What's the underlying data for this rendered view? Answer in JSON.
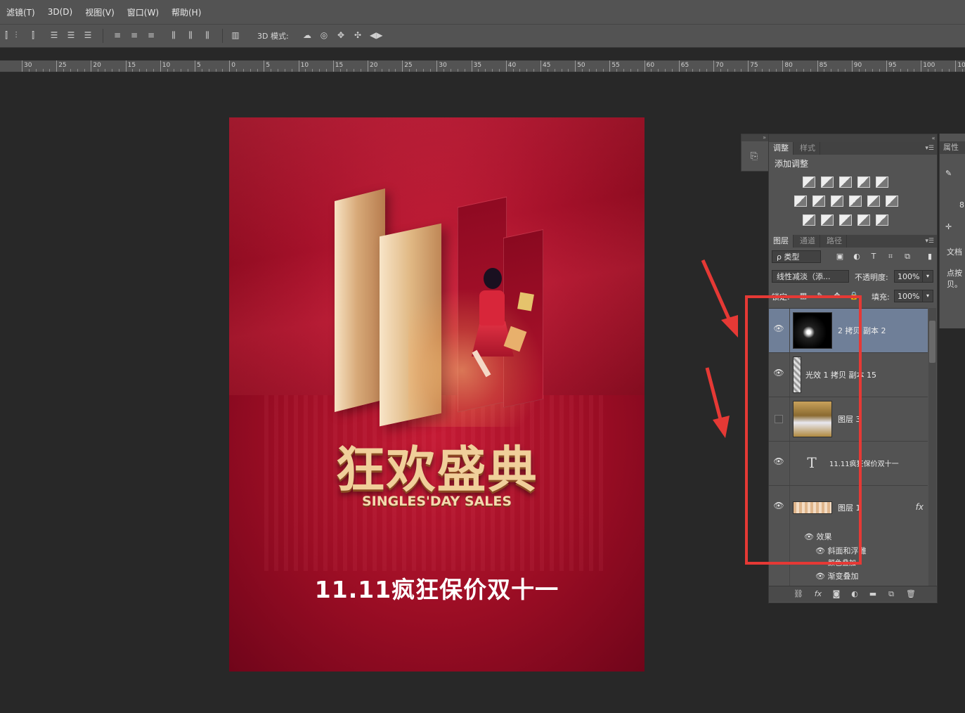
{
  "menu": [
    "滤镜(T)",
    "3D(D)",
    "视图(V)",
    "窗口(W)",
    "帮助(H)"
  ],
  "options_bar": {
    "mode_label": "3D 模式:"
  },
  "ruler": {
    "ticks": [
      "30",
      "25",
      "20",
      "15",
      "10",
      "5",
      "0",
      "5",
      "10",
      "15",
      "20",
      "25",
      "30",
      "35",
      "40",
      "45",
      "50",
      "55",
      "60",
      "65",
      "70",
      "75",
      "80",
      "85",
      "90",
      "95",
      "100",
      "10"
    ]
  },
  "poster": {
    "title": "狂欢盛典",
    "subtitle": "SINGLES'DAY SALES",
    "slogan": "11.11疯狂保价双十一"
  },
  "adjustments_panel": {
    "tabs": [
      "调整",
      "样式"
    ],
    "heading": "添加调整"
  },
  "properties_panel": {
    "tab": "属性",
    "doc_tab": "文档",
    "hint": "点按 贝。",
    "value": "8"
  },
  "layers_panel": {
    "tabs": [
      "图层",
      "通道",
      "路径"
    ],
    "filter_kind": "ρ 类型",
    "blend_mode": "线性减淡（添...",
    "opacity_label": "不透明度:",
    "opacity_value": "100%",
    "lock_label": "锁定:",
    "fill_label": "填充:",
    "fill_value": "100%",
    "layers": [
      {
        "name": "2 拷贝 副本 2",
        "visible": true,
        "selected": true
      },
      {
        "name": "光效 1 拷贝 副本 15",
        "visible": true,
        "selected": false
      },
      {
        "name": "图层 3",
        "visible": false,
        "selected": false
      },
      {
        "name": "11.11疯狂保价双十一",
        "visible": true,
        "selected": false,
        "type": "text"
      },
      {
        "name": "图层 1",
        "visible": true,
        "selected": false,
        "has_fx": true
      }
    ],
    "effects": {
      "label": "效果",
      "items": [
        "斜面和浮雕",
        "颜色叠加",
        "渐变叠加"
      ]
    }
  },
  "annotation": {
    "color": "#e53935"
  }
}
